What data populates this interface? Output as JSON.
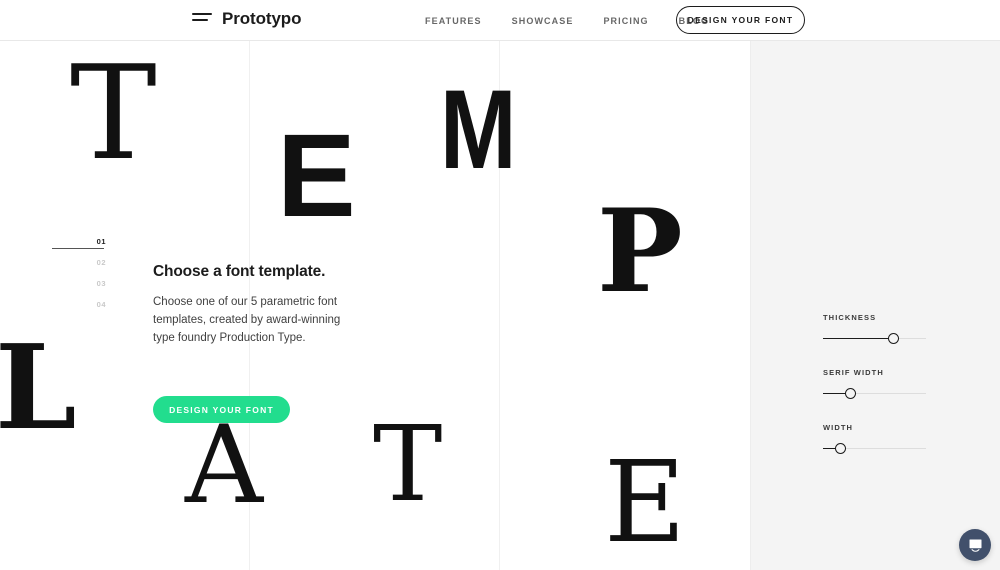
{
  "header": {
    "menu_icon": "hamburger-menu-icon",
    "brand": "Prototypo",
    "nav": [
      {
        "label": "FEATURES"
      },
      {
        "label": "SHOWCASE"
      },
      {
        "label": "PRICING"
      },
      {
        "label": "BLOG"
      }
    ],
    "cta_label": "DESIGN YOUR FONT"
  },
  "stage": {
    "glyphs": [
      {
        "char": "T",
        "style": "serif"
      },
      {
        "char": "E",
        "style": "sans-bold"
      },
      {
        "char": "M",
        "style": "sans-bold-condensed"
      },
      {
        "char": "P",
        "style": "serif-bold"
      },
      {
        "char": "L",
        "style": "slab-bold"
      },
      {
        "char": "A",
        "style": "serif"
      },
      {
        "char": "T",
        "style": "serif-light"
      },
      {
        "char": "E",
        "style": "serif"
      }
    ]
  },
  "steps": [
    {
      "num": "01",
      "active": true
    },
    {
      "num": "02",
      "active": false
    },
    {
      "num": "03",
      "active": false
    },
    {
      "num": "04",
      "active": false
    }
  ],
  "copy": {
    "heading": "Choose a font template.",
    "body": "Choose one of our 5 parametric font templates, created by award-winning type foundry Production Type.",
    "cta_label": "DESIGN YOUR FONT"
  },
  "sliders": [
    {
      "label": "THICKNESS",
      "value": 68
    },
    {
      "label": "SERIF WIDTH",
      "value": 27
    },
    {
      "label": "WIDTH",
      "value": 17
    }
  ],
  "chat": {
    "icon": "chat-message-icon"
  },
  "colors": {
    "accent_green": "#22DD8E",
    "ink": "#1c1c1c",
    "panel_gray": "#f4f4f4",
    "chat_bubble": "#41506b"
  }
}
